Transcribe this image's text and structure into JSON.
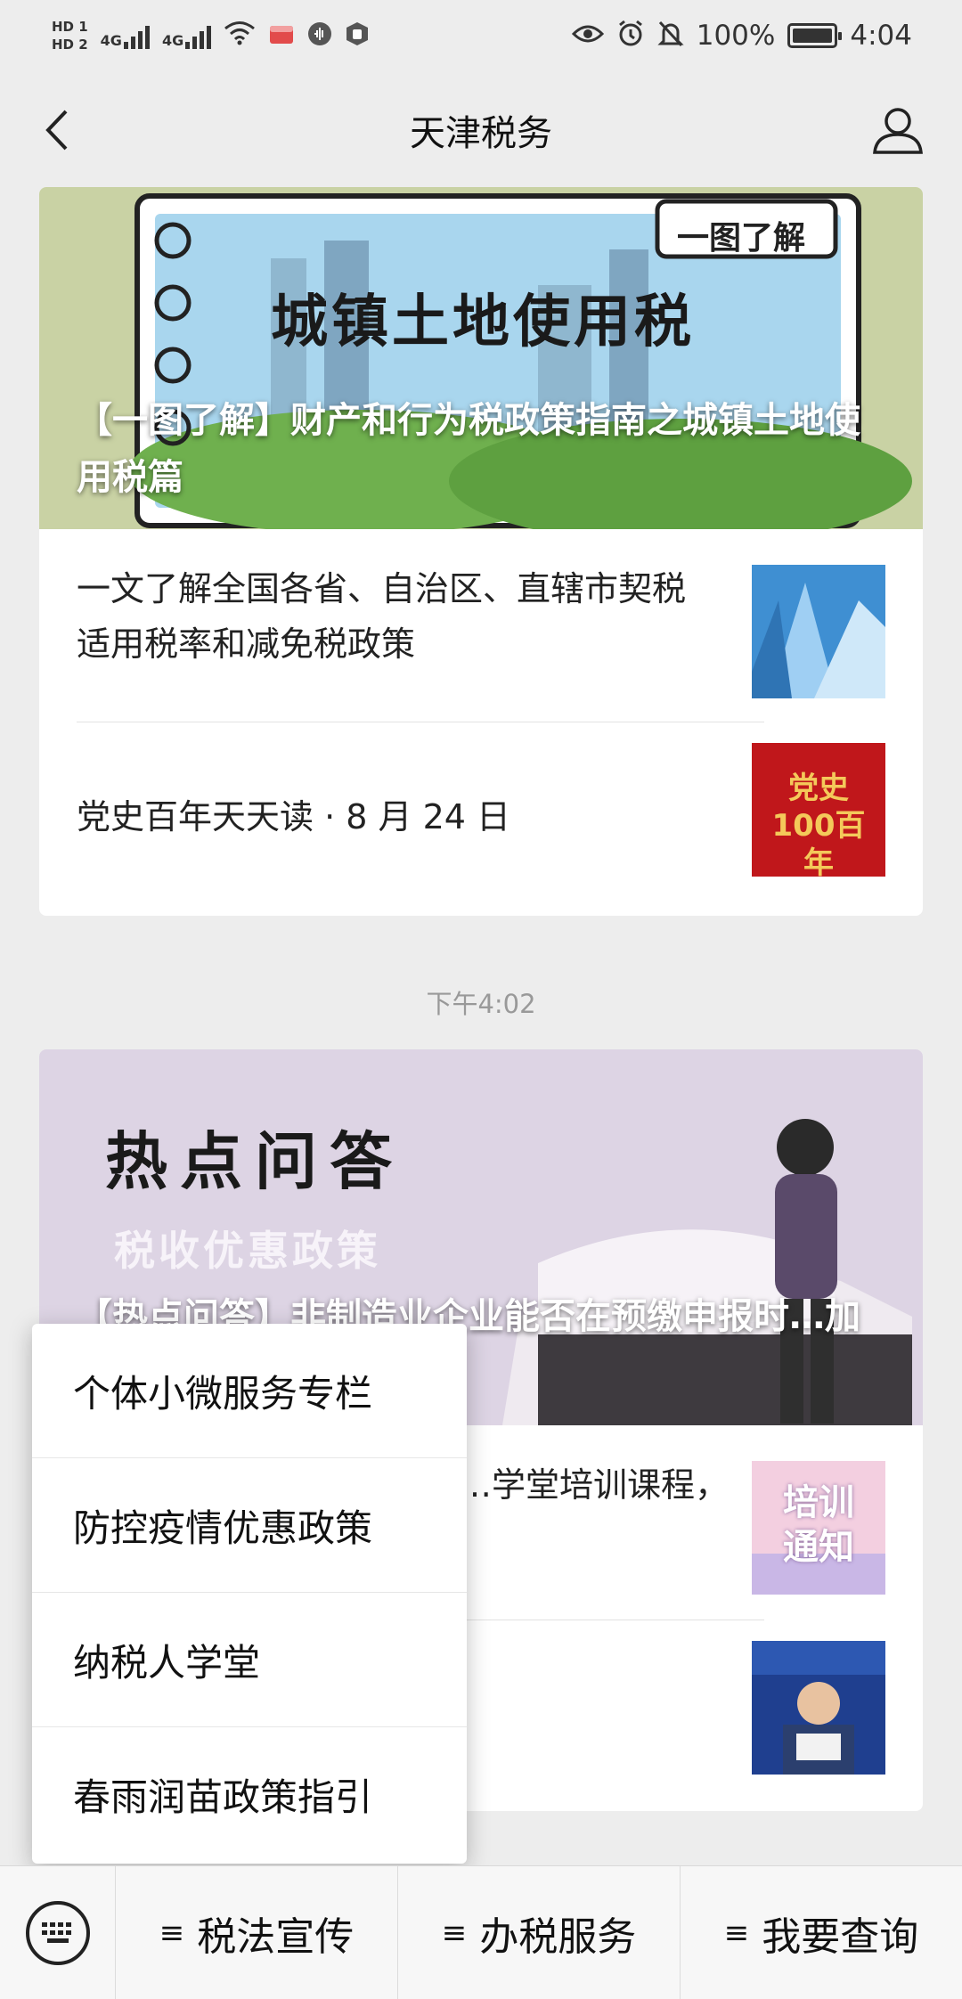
{
  "status_bar": {
    "hd1": "HD 1",
    "hd2": "HD 2",
    "net1": "4G",
    "net2": "4G",
    "battery_text": "100%",
    "time": "4:04",
    "battery_level": 1.0
  },
  "header": {
    "title": "天津税务"
  },
  "card1": {
    "hero_art_title": "城镇土地使用税",
    "hero_tag": "一图了解",
    "hero_caption": "【一图了解】财产和行为税政策指南之城镇土地使用税篇",
    "articles": [
      {
        "title": "一文了解全国各省、自治区、直辖市契税适用税率和减免税政策"
      },
      {
        "title": "党史百年天天读 · 8 月 24 日",
        "thumb_text": "党史100百年"
      }
    ]
  },
  "timestamp": "下午4:02",
  "card2": {
    "hero_art_title": "热点问答",
    "hero_art_subtitle": "税收优惠政策",
    "hero_caption": "【热点问答】非制造业企业能否在预缴申报时…加计扣除优惠政策？",
    "articles": [
      {
        "title": "…学堂培训课程，",
        "thumb_text": "培训通知"
      },
      {
        "title": ""
      }
    ]
  },
  "popup_menu": {
    "items": [
      "个体小微服务专栏",
      "防控疫情优惠政策",
      "纳税人学堂",
      "春雨润苗政策指引"
    ]
  },
  "bottom_menu": {
    "tabs": [
      {
        "label": "税法宣传",
        "glyph": "≡"
      },
      {
        "label": "办税服务",
        "glyph": "≡"
      },
      {
        "label": "我要查询",
        "glyph": "≡"
      }
    ]
  }
}
